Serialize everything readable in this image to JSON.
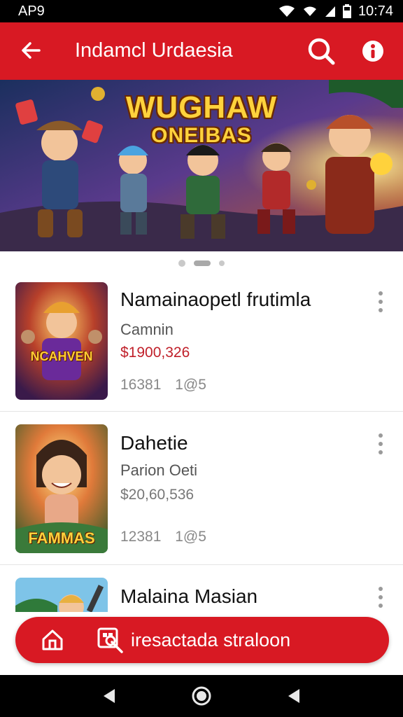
{
  "status_bar": {
    "carrier": "AP9",
    "time": "10:74",
    "icons": [
      "wifi-icon",
      "signal-icon",
      "battery-icon"
    ]
  },
  "app_bar": {
    "title": "Indamcl Urdaesia",
    "back_icon": "arrow-left-icon",
    "search_icon": "search-icon",
    "info_icon": "info-icon"
  },
  "banner": {
    "title_line1": "WUGHAW",
    "title_line2": "ONEIBAS",
    "pager": {
      "count": 3,
      "active_index": 1
    }
  },
  "list": [
    {
      "title": "Namainaopetl frutimla",
      "subtitle": "Camnin",
      "price": "$1900,326",
      "meta1": "16381",
      "meta2": "1@5",
      "thumb_caption": "NCAHVEN"
    },
    {
      "title": "Dahetie",
      "subtitle": "Parion Oeti",
      "price": "$20,60,536",
      "meta1": "12381",
      "meta2": "1@5",
      "thumb_caption": "FAMMAS"
    },
    {
      "title": "Malaina Masian"
    }
  ],
  "cta": {
    "label": "iresactada straloon",
    "home_icon": "home-icon",
    "icon": "store-icon"
  },
  "nav_bar": {
    "icons": [
      "back-triangle-icon",
      "home-circle-icon",
      "recent-triangle-icon"
    ]
  },
  "colors": {
    "brand_red": "#d81923",
    "price_red": "#c0202a",
    "price_gray": "#777777",
    "text_dark": "#111111",
    "text_gray": "#555555"
  }
}
